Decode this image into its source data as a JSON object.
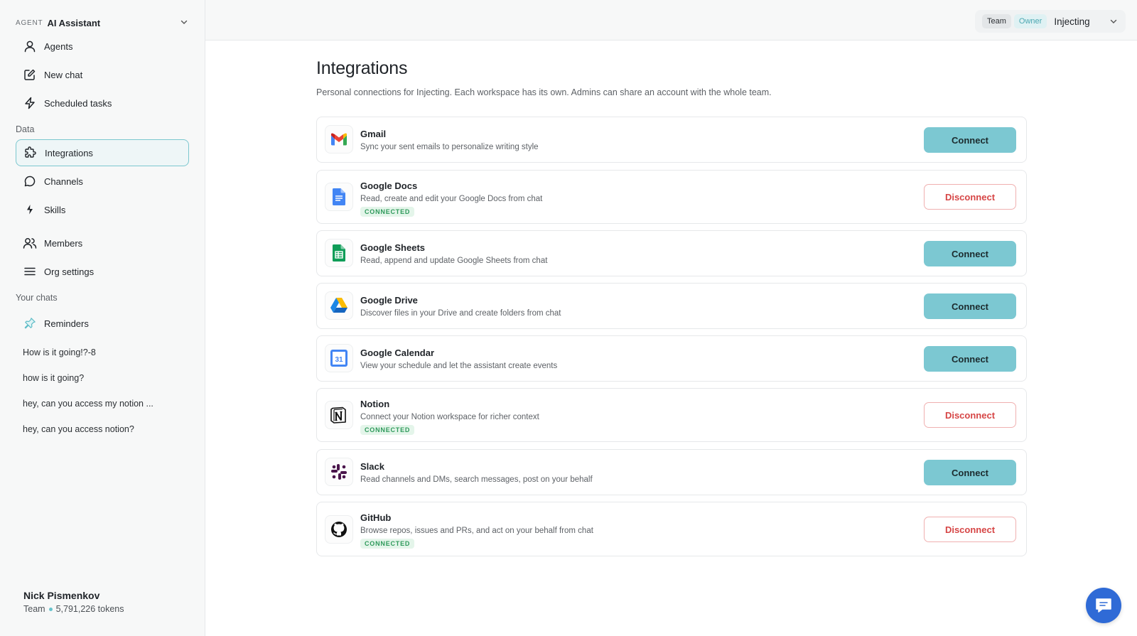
{
  "sidebar": {
    "agent": {
      "tag": "AGENT",
      "name": "AI Assistant"
    },
    "nav": [
      {
        "label": "Agents",
        "icon": "person-icon"
      },
      {
        "label": "New chat",
        "icon": "edit-icon"
      },
      {
        "label": "Scheduled tasks",
        "icon": "bolt-icon"
      }
    ],
    "data_section": "Data",
    "data_items": [
      {
        "label": "Integrations",
        "icon": "puzzle-icon"
      },
      {
        "label": "Channels",
        "icon": "chat-bubble-icon"
      },
      {
        "label": "Skills",
        "icon": "sparkle-bolt-icon"
      },
      {
        "label": "Members",
        "icon": "users-icon"
      },
      {
        "label": "Org settings",
        "icon": "menu-icon"
      }
    ],
    "chats_section": "Your chats",
    "pinned": {
      "label": "Reminders",
      "icon": "pin-icon"
    },
    "chats": [
      "How is it going!?-8",
      "how is it going?",
      "hey, can you access my notion ...",
      "hey, can you access notion?"
    ],
    "user": {
      "name": "Nick Pismenkov",
      "plan": "Team",
      "tokens": "5,791,226 tokens"
    }
  },
  "topbar": {
    "badge_team": "Team",
    "badge_owner": "Owner",
    "workspace": "Injecting"
  },
  "page": {
    "title": "Integrations",
    "subtitle": "Personal connections for Injecting. Each workspace has its own. Admins can share an account with the whole team."
  },
  "integrations": [
    {
      "name": "Gmail",
      "desc": "Sync your sent emails to personalize writing style",
      "connected": false,
      "badge": "",
      "action": "Connect",
      "icon": "gmail-icon"
    },
    {
      "name": "Google Docs",
      "desc": "Read, create and edit your Google Docs from chat",
      "connected": true,
      "badge": "CONNECTED",
      "action": "Disconnect",
      "icon": "google-docs-icon"
    },
    {
      "name": "Google Sheets",
      "desc": "Read, append and update Google Sheets from chat",
      "connected": false,
      "badge": "",
      "action": "Connect",
      "icon": "google-sheets-icon"
    },
    {
      "name": "Google Drive",
      "desc": "Discover files in your Drive and create folders from chat",
      "connected": false,
      "badge": "",
      "action": "Connect",
      "icon": "google-drive-icon"
    },
    {
      "name": "Google Calendar",
      "desc": "View your schedule and let the assistant create events",
      "connected": false,
      "badge": "",
      "action": "Connect",
      "icon": "google-calendar-icon",
      "calendar_day": "31"
    },
    {
      "name": "Notion",
      "desc": "Connect your Notion workspace for richer context",
      "connected": true,
      "badge": "CONNECTED",
      "action": "Disconnect",
      "icon": "notion-icon"
    },
    {
      "name": "Slack",
      "desc": "Read channels and DMs, search messages, post on your behalf",
      "connected": false,
      "badge": "",
      "action": "Connect",
      "icon": "slack-icon"
    },
    {
      "name": "GitHub",
      "desc": "Browse repos, issues and PRs, and act on your behalf from chat",
      "connected": true,
      "badge": "CONNECTED",
      "action": "Disconnect",
      "icon": "github-icon"
    }
  ],
  "colors": {
    "accent": "#7cc8d2",
    "danger": "#d64545",
    "connected_green": "#2f9a5b",
    "fab": "#2f6ad6"
  }
}
